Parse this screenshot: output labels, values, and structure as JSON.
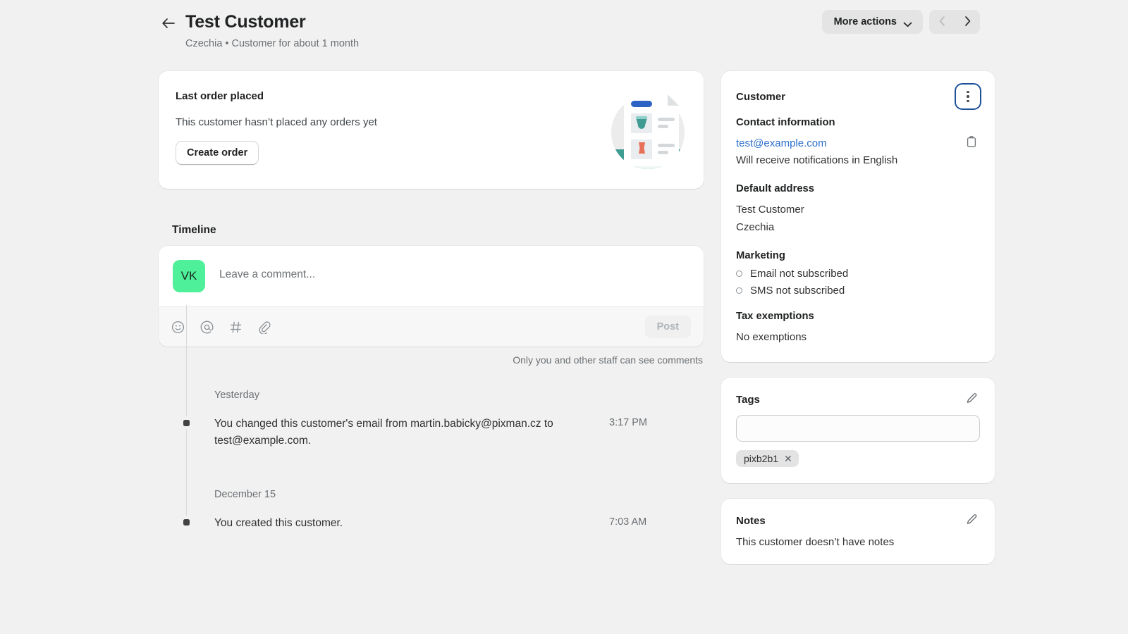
{
  "header": {
    "back_icon": "arrow-left-icon",
    "title": "Test Customer",
    "subtitle": "Czechia • Customer for about 1 month",
    "more_actions_label": "More actions",
    "chevron_icon": "chevron-down-icon",
    "prev_icon": "chevron-left-icon",
    "next_icon": "chevron-right-icon"
  },
  "order_card": {
    "heading": "Last order placed",
    "message": "This customer hasn’t placed any orders yet",
    "button_label": "Create order",
    "illustration": "order-receipt-illustration"
  },
  "timeline": {
    "title": "Timeline",
    "avatar_initials": "VK",
    "comment_placeholder": "Leave a comment...",
    "comment_value": "",
    "tools": [
      {
        "name": "emoji-icon",
        "glyph": "☺"
      },
      {
        "name": "mention-icon",
        "glyph": "@"
      },
      {
        "name": "hashtag-icon",
        "glyph": "#"
      },
      {
        "name": "attachment-icon",
        "glyph": "🔗"
      }
    ],
    "post_label": "Post",
    "visibility_note": "Only you and other staff can see comments",
    "groups": [
      {
        "day": "Yesterday",
        "events": [
          {
            "text": "You changed this customer's email from martin.babicky@pixman.cz to test@example.com.",
            "time": "3:17 PM"
          }
        ]
      },
      {
        "day": "December 15",
        "events": [
          {
            "text": "You created this customer.",
            "time": "7:03 AM"
          }
        ]
      }
    ]
  },
  "customer_card": {
    "title": "Customer",
    "kebab_icon": "more-vertical-icon",
    "contact_heading": "Contact information",
    "email": "test@example.com",
    "copy_icon": "clipboard-copy-icon",
    "notification_note": "Will receive notifications in English",
    "address_heading": "Default address",
    "address_lines": [
      "Test Customer",
      "Czechia"
    ],
    "marketing_heading": "Marketing",
    "marketing_items": [
      "Email not subscribed",
      "SMS not subscribed"
    ],
    "tax_heading": "Tax exemptions",
    "tax_value": "No exemptions"
  },
  "tags_card": {
    "title": "Tags",
    "edit_icon": "pencil-icon",
    "input_value": "",
    "input_placeholder": "",
    "tags": [
      {
        "label": "pixb2b1",
        "remove_icon": "close-icon"
      }
    ]
  },
  "notes_card": {
    "title": "Notes",
    "edit_icon": "pencil-icon",
    "empty_text": "This customer doesn’t have notes"
  },
  "colors": {
    "page_bg": "#f1f1f1",
    "card_bg": "#ffffff",
    "link": "#2c6ecb",
    "avatar_bg": "#4ef09a",
    "focus_ring": "#1f5199",
    "illustration_teal": "#3f9c93",
    "illustration_blue": "#2b62c4",
    "illustration_red": "#e8705a"
  }
}
